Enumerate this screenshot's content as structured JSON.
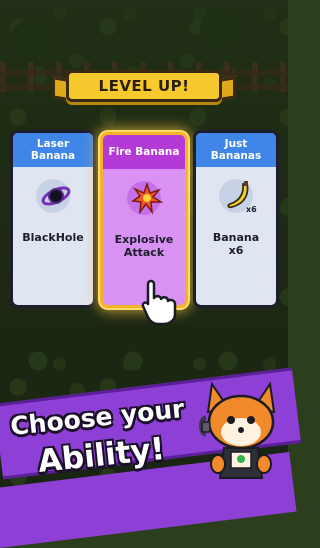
{
  "banner": {
    "title": "LEVEL UP!"
  },
  "cards": [
    {
      "header": "Laser\nBanana",
      "name": "BlackHole",
      "icon": "black-hole-icon",
      "color": "#3f86e8"
    },
    {
      "header": "Fire Banana",
      "name": "Explosive\nAttack",
      "icon": "explosion-icon",
      "color": "#b33ad6",
      "selected": true
    },
    {
      "header": "Just Bananas",
      "name": "Banana\nx6",
      "icon": "banana-icon",
      "badge": "x6",
      "color": "#3f86e8"
    }
  ],
  "promo": {
    "line1": "Choose your",
    "line2": "Ability!"
  },
  "colors": {
    "accent": "#8e3fd6",
    "banner": "#f6c92c",
    "selected_glow": "#f5b12a"
  }
}
